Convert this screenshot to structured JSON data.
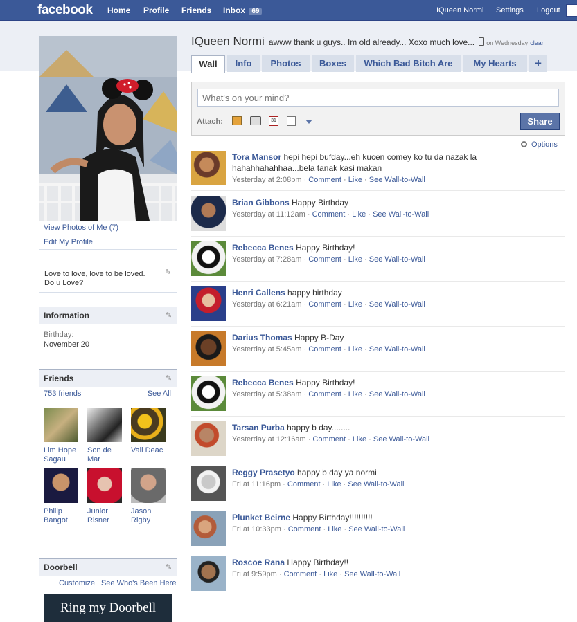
{
  "topbar": {
    "logo": "facebook",
    "nav": [
      "Home",
      "Profile",
      "Friends"
    ],
    "inbox_label": "Inbox",
    "inbox_count": "69",
    "user_name": "IQueen Normi",
    "settings": "Settings",
    "logout": "Logout"
  },
  "profile": {
    "name": "IQueen Normi",
    "status": "awww thank u guys.. Im old already... Xoxo much love...",
    "status_time": "on Wednesday",
    "clear": "clear"
  },
  "tabs": [
    "Wall",
    "Info",
    "Photos",
    "Boxes",
    "Which Bad Bitch Are",
    "My Hearts",
    "+"
  ],
  "composer": {
    "placeholder": "What's on your mind?",
    "attach_label": "Attach:",
    "share_label": "Share"
  },
  "options_label": "Options",
  "left": {
    "view_photos": "View Photos of Me (7)",
    "edit_profile": "Edit My Profile",
    "bio_line1": "Love to love, love to be loved.",
    "bio_line2": "Do u Love?",
    "info_title": "Information",
    "birthday_label": "Birthday:",
    "birthday_value": "November 20",
    "friends_title": "Friends",
    "friends_count": "753 friends",
    "see_all": "See All",
    "friends": [
      {
        "line1": "Lim Hope",
        "line2": "Sagau"
      },
      {
        "line1": "Son de Mar",
        "line2": ""
      },
      {
        "line1": "Vali Deac",
        "line2": ""
      },
      {
        "line1": "Philip",
        "line2": "Bangot"
      },
      {
        "line1": "Junior",
        "line2": "Risner"
      },
      {
        "line1": "Jason",
        "line2": "Rigby"
      }
    ],
    "doorbell_title": "Doorbell",
    "doorbell_customize": "Customize",
    "doorbell_sep": "|",
    "doorbell_see": "See Who's Been Here",
    "doorbell_banner": "Ring my Doorbell"
  },
  "posts": [
    {
      "name": "Tora Mansor",
      "text": "hepi hepi bufday...eh kucen comey ko tu da nazak la hahahhahahhaa...bela tanak kasi makan",
      "time": "Yesterday at 2:08pm"
    },
    {
      "name": "Brian Gibbons",
      "text": "Happy Birthday",
      "time": "Yesterday at 11:12am"
    },
    {
      "name": "Rebecca Benes",
      "text": "Happy Birthday!",
      "time": "Yesterday at 7:28am"
    },
    {
      "name": "Henri Callens",
      "text": "happy birthday",
      "time": "Yesterday at 6:21am"
    },
    {
      "name": "Darius Thomas",
      "text": "Happy B-Day",
      "time": "Yesterday at 5:45am"
    },
    {
      "name": "Rebecca Benes",
      "text": "Happy Birthday!",
      "time": "Yesterday at 5:38am"
    },
    {
      "name": "Tarsan Purba",
      "text": "happy b day........",
      "time": "Yesterday at 12:16am"
    },
    {
      "name": "Reggy Prasetyo",
      "text": "happy b day ya normi",
      "time": "Fri at 11:16pm"
    },
    {
      "name": "Plunket Beirne",
      "text": "Happy Birthday!!!!!!!!!!",
      "time": "Fri at 10:33pm"
    },
    {
      "name": "Roscoe Rana",
      "text": "Happy Birthday!!",
      "time": "Fri at 9:59pm"
    }
  ],
  "post_actions": {
    "comment": "Comment",
    "like": "Like",
    "wall": "See Wall-to-Wall",
    "sep": "·"
  },
  "colors": {
    "brand": "#3b5998",
    "tab_bg": "#d8dfea",
    "share_btn": "#5b74a8"
  }
}
